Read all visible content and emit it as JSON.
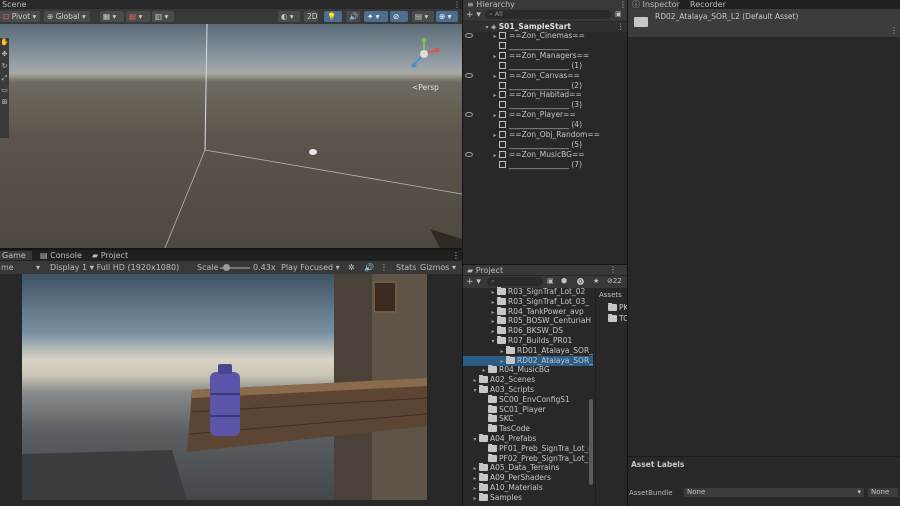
{
  "scene": {
    "tab": "Scene",
    "pivot": "Pivot",
    "global": "Global",
    "mode_2d": "2D",
    "persp": "<Persp"
  },
  "game": {
    "tabs": [
      "Game",
      "Console",
      "Project"
    ],
    "mode": "me",
    "display": "Display 1",
    "resolution": "Full HD (1920x1080)",
    "scale_label": "Scale",
    "scale_value": "0.43x",
    "play_focused": "Play Focused",
    "stats": "Stats",
    "gizmos": "Gizmos",
    "scale_level": 0.2
  },
  "hierarchy": {
    "tab": "Hierarchy",
    "search_placeholder": "All",
    "scene_name": "S01_SampleStart",
    "items": [
      {
        "label": "==Zon_Cinemas==",
        "kind": "group"
      },
      {
        "label": "________________",
        "kind": "sep"
      },
      {
        "label": "==Zon_Managers==",
        "kind": "group"
      },
      {
        "label": "________________ (1)",
        "kind": "sep"
      },
      {
        "label": "==Zon_Canvas==",
        "kind": "group"
      },
      {
        "label": "________________ (2)",
        "kind": "sep"
      },
      {
        "label": "==Zon_Habitad==",
        "kind": "group"
      },
      {
        "label": "________________ (3)",
        "kind": "sep"
      },
      {
        "label": "==Zon_Player==",
        "kind": "group"
      },
      {
        "label": "________________ (4)",
        "kind": "sep"
      },
      {
        "label": "==Zon_Obj_Random==",
        "kind": "group"
      },
      {
        "label": "________________ (5)",
        "kind": "sep"
      },
      {
        "label": "==Zon_MusicBG==",
        "kind": "group"
      },
      {
        "label": "________________ (7)",
        "kind": "sep"
      }
    ]
  },
  "project": {
    "tab": "Project",
    "count": "22",
    "assets_label": "Assets",
    "assets_items": [
      "PK",
      "TC"
    ],
    "tree": [
      {
        "label": "R03_SignTraf_Lot_02",
        "indent": 2,
        "arrow": "▸"
      },
      {
        "label": "R03_SignTraf_Lot_03_",
        "indent": 2,
        "arrow": "▸"
      },
      {
        "label": "R04_TankPower_avp",
        "indent": 2,
        "arrow": "▸"
      },
      {
        "label": "R05_BOSW_CenturiaH",
        "indent": 2,
        "arrow": "▸"
      },
      {
        "label": "R06_BKSW_DS",
        "indent": 2,
        "arrow": "▸"
      },
      {
        "label": "R07_Builds_PR01",
        "indent": 2,
        "arrow": "▾"
      },
      {
        "label": "RD01_Atalaya_SOR_",
        "indent": 3,
        "arrow": "▸"
      },
      {
        "label": "RD02_Atalaya_SOR_",
        "indent": 3,
        "arrow": "▸",
        "selected": true
      },
      {
        "label": "R04_MusicBG",
        "indent": 1,
        "arrow": "▸"
      },
      {
        "label": "A02_Scenes",
        "indent": 0,
        "arrow": "▸"
      },
      {
        "label": "A03_Scripts",
        "indent": 0,
        "arrow": "▾"
      },
      {
        "label": "SC00_EnvConfigS1",
        "indent": 1,
        "arrow": ""
      },
      {
        "label": "SC01_Player",
        "indent": 1,
        "arrow": ""
      },
      {
        "label": "SKC",
        "indent": 1,
        "arrow": ""
      },
      {
        "label": "TasCode",
        "indent": 1,
        "arrow": ""
      },
      {
        "label": "A04_Prefabs",
        "indent": 0,
        "arrow": "▾"
      },
      {
        "label": "PF01_Preb_SignTra_Lot_(",
        "indent": 1,
        "arrow": ""
      },
      {
        "label": "PF02_Preb_SignTra_Lot_(",
        "indent": 1,
        "arrow": ""
      },
      {
        "label": "A05_Data_Terrains",
        "indent": 0,
        "arrow": "▸"
      },
      {
        "label": "A09_PerShaders",
        "indent": 0,
        "arrow": "▸"
      },
      {
        "label": "A10_Materials",
        "indent": 0,
        "arrow": "▸"
      },
      {
        "label": "Samples",
        "indent": 0,
        "arrow": "▸"
      }
    ]
  },
  "inspector": {
    "tabs": [
      "Inspector",
      "Recorder"
    ],
    "asset_title": "RD02_Atalaya_SOR_L2 (Default Asset)",
    "asset_labels": "Asset Labels",
    "asset_bundle": "AssetBundle",
    "bundle_value": "None",
    "variant_value": "None"
  },
  "colors": {
    "selection": "#2c5d87",
    "panel": "#282828",
    "toolbar": "#383838",
    "accent_blue": "#4c8fd6"
  }
}
